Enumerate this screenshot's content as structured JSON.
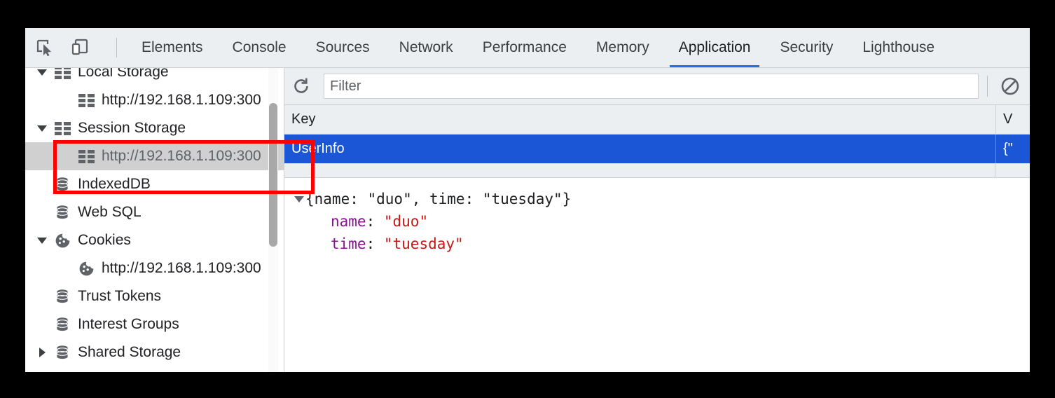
{
  "toolbar": {
    "inspect_icon": "inspect-element-icon",
    "device_icon": "device-toolbar-icon",
    "tabs": [
      {
        "label": "Elements",
        "active": false
      },
      {
        "label": "Console",
        "active": false
      },
      {
        "label": "Sources",
        "active": false
      },
      {
        "label": "Network",
        "active": false
      },
      {
        "label": "Performance",
        "active": false
      },
      {
        "label": "Memory",
        "active": false
      },
      {
        "label": "Application",
        "active": true
      },
      {
        "label": "Security",
        "active": false
      },
      {
        "label": "Lighthouse",
        "active": false
      }
    ],
    "active_tab": "Application",
    "accent_color": "#1a73e8"
  },
  "sidebar": {
    "items": [
      {
        "label": "Local Storage",
        "icon": "storage-grid-icon",
        "twisty": "down",
        "depth": 0,
        "selected": false,
        "dim": false
      },
      {
        "label": "http://192.168.1.109:300",
        "icon": "storage-grid-icon",
        "twisty": "none",
        "depth": 1,
        "selected": false,
        "dim": false
      },
      {
        "label": "Session Storage",
        "icon": "storage-grid-icon",
        "twisty": "down",
        "depth": 0,
        "selected": false,
        "dim": false
      },
      {
        "label": "http://192.168.1.109:300",
        "icon": "storage-grid-icon",
        "twisty": "none",
        "depth": 1,
        "selected": true,
        "dim": true
      },
      {
        "label": "IndexedDB",
        "icon": "database-icon",
        "twisty": "none",
        "depth": 0,
        "selected": false,
        "dim": false
      },
      {
        "label": "Web SQL",
        "icon": "database-icon",
        "twisty": "none",
        "depth": 0,
        "selected": false,
        "dim": false
      },
      {
        "label": "Cookies",
        "icon": "cookie-icon",
        "twisty": "down",
        "depth": 0,
        "selected": false,
        "dim": false
      },
      {
        "label": "http://192.168.1.109:300",
        "icon": "cookie-icon",
        "twisty": "none",
        "depth": 1,
        "selected": false,
        "dim": false
      },
      {
        "label": "Trust Tokens",
        "icon": "database-icon",
        "twisty": "none",
        "depth": 0,
        "selected": false,
        "dim": false
      },
      {
        "label": "Interest Groups",
        "icon": "database-icon",
        "twisty": "none",
        "depth": 0,
        "selected": false,
        "dim": false
      },
      {
        "label": "Shared Storage",
        "icon": "database-icon",
        "twisty": "right",
        "depth": 0,
        "selected": false,
        "dim": false
      }
    ]
  },
  "main": {
    "filterbar": {
      "refresh_icon": "refresh-icon",
      "filter_placeholder": "Filter",
      "filter_value": "",
      "clear_icon": "clear-all-icon"
    },
    "table": {
      "columns": [
        {
          "label": "Key"
        },
        {
          "label": "V"
        }
      ],
      "rows": [
        {
          "key": "UserInfo",
          "value": "{\"",
          "selected": true
        }
      ],
      "selected_row_color": "#1a56d6"
    },
    "preview": {
      "summary": "{name: \"duo\", time: \"tuesday\"}",
      "expanded": true,
      "entries": [
        {
          "key": "name",
          "value": "\"duo\""
        },
        {
          "key": "time",
          "value": "\"tuesday\""
        }
      ],
      "property_color": "#881391",
      "string_color": "#c41a16"
    }
  },
  "annotation": {
    "color": "#ff0000",
    "label": "session-storage-highlight"
  }
}
